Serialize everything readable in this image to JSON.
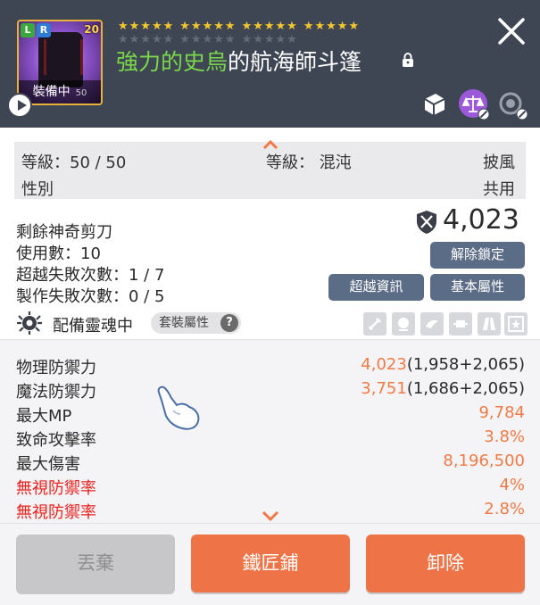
{
  "header": {
    "item_name_prefix": "強力的史烏",
    "item_name_rest": "的航海師斗篷",
    "thumbnail": {
      "badge_l": "L",
      "badge_r": "R",
      "level_badge": "20",
      "equipped_label": "裝備中",
      "sub_level": "50"
    },
    "stars": {
      "filled_groups": [
        "★★★★★",
        "★★★★★",
        "★★★★★",
        "★★★★★"
      ],
      "empty_groups": [
        "★★★★★",
        "★★★★★",
        "★★★★★"
      ]
    },
    "icons": [
      "play-icon",
      "lock-icon",
      "close-icon",
      "scroll-icon",
      "scale-icon",
      "enhance-icon"
    ],
    "colors": {
      "header_bg": "#3e4654",
      "prefix_green": "#7bd84a",
      "star_gold": "#f5c72c"
    }
  },
  "info": {
    "level_label": "等級：50 / 50",
    "gender_label": "性別",
    "rank_label": "等級： 混沌",
    "slot_type": "披風",
    "gender_value": "共用",
    "remaining_scissors": "剩餘神奇剪刀",
    "usage_count": "使用數：10",
    "transcend_fail": "超越失敗次數：1 / 7",
    "craft_fail": "製作失敗次數：0 / 5",
    "power_value": "4,023",
    "buttons": {
      "unlock": "解除鎖定",
      "transcend_info": "超越資訊",
      "base_attr": "基本屬性"
    },
    "soul_label": "配備靈魂中",
    "set_label": "套裝屬性",
    "set_help": "?"
  },
  "stats": [
    {
      "label": "物理防禦力",
      "value": "4,023",
      "detail": "(1,958+2,065)",
      "red": false
    },
    {
      "label": "魔法防禦力",
      "value": "3,751",
      "detail": "(1,686+2,065)",
      "red": false
    },
    {
      "label": "最大MP",
      "value": "9,784",
      "detail": "",
      "red": false
    },
    {
      "label": "致命攻擊率",
      "value": "3.8%",
      "detail": "",
      "red": false
    },
    {
      "label": "最大傷害",
      "value": "8,196,500",
      "detail": "",
      "red": false
    },
    {
      "label": "無視防禦率",
      "value": "4%",
      "detail": "",
      "red": true
    },
    {
      "label": "無視防禦率",
      "value": "2.8%",
      "detail": "",
      "red": true
    }
  ],
  "footer": {
    "discard": "丟棄",
    "blacksmith": "鐵匠鋪",
    "unequip": "卸除"
  }
}
